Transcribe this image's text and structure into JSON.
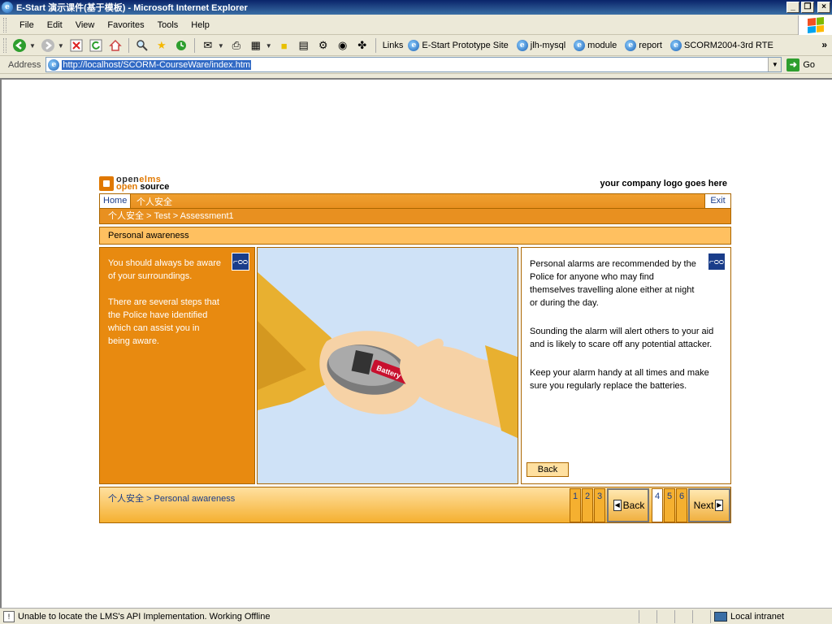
{
  "window": {
    "title": "E-Start 演示课件(基于模板) - Microsoft Internet Explorer",
    "minimize": "_",
    "restore": "❐",
    "close": "×"
  },
  "menu": {
    "items": [
      "File",
      "Edit",
      "View",
      "Favorites",
      "Tools",
      "Help"
    ]
  },
  "toolbar": {
    "links_label": "Links",
    "links": [
      "E-Start Prototype Site",
      "jlh-mysql",
      "module",
      "report",
      "SCORM2004-3rd RTE"
    ],
    "more": "»"
  },
  "address": {
    "label": "Address",
    "url": "http://localhost/SCORM-CourseWare/index.htm",
    "go_label": "Go"
  },
  "course": {
    "logo_line1a": "open",
    "logo_line1b": "elms",
    "logo_line2a": "open",
    "logo_line2b": "source",
    "company_logo": "your company logo goes here",
    "home": "Home",
    "module_title": "个人安全",
    "exit": "Exit",
    "breadcrumb": "个人安全 > Test > Assessment1",
    "page_title": "Personal awareness",
    "left_text": [
      "You should always be aware of your surroundings.",
      "There are several steps that the Police have identified which can assist you in being aware."
    ],
    "right_text": [
      "Personal alarms are recommended by the Police for anyone who may find themselves travelling alone either at night or during the day.",
      "Sounding the alarm will alert others to your aid and is likely to scare off any potential attacker.",
      "Keep your alarm handy at all times and make sure you regularly replace the batteries."
    ],
    "back_small": "Back",
    "battery_label": "Battery",
    "bottom_crumb": "个人安全 > Personal awareness",
    "pages": [
      "1",
      "2",
      "3",
      "4",
      "5",
      "6"
    ],
    "current_page": "4",
    "back": "Back",
    "next": "Next"
  },
  "status": {
    "text": "Unable to locate the LMS's API Implementation. Working Offline",
    "zone": "Local intranet"
  }
}
